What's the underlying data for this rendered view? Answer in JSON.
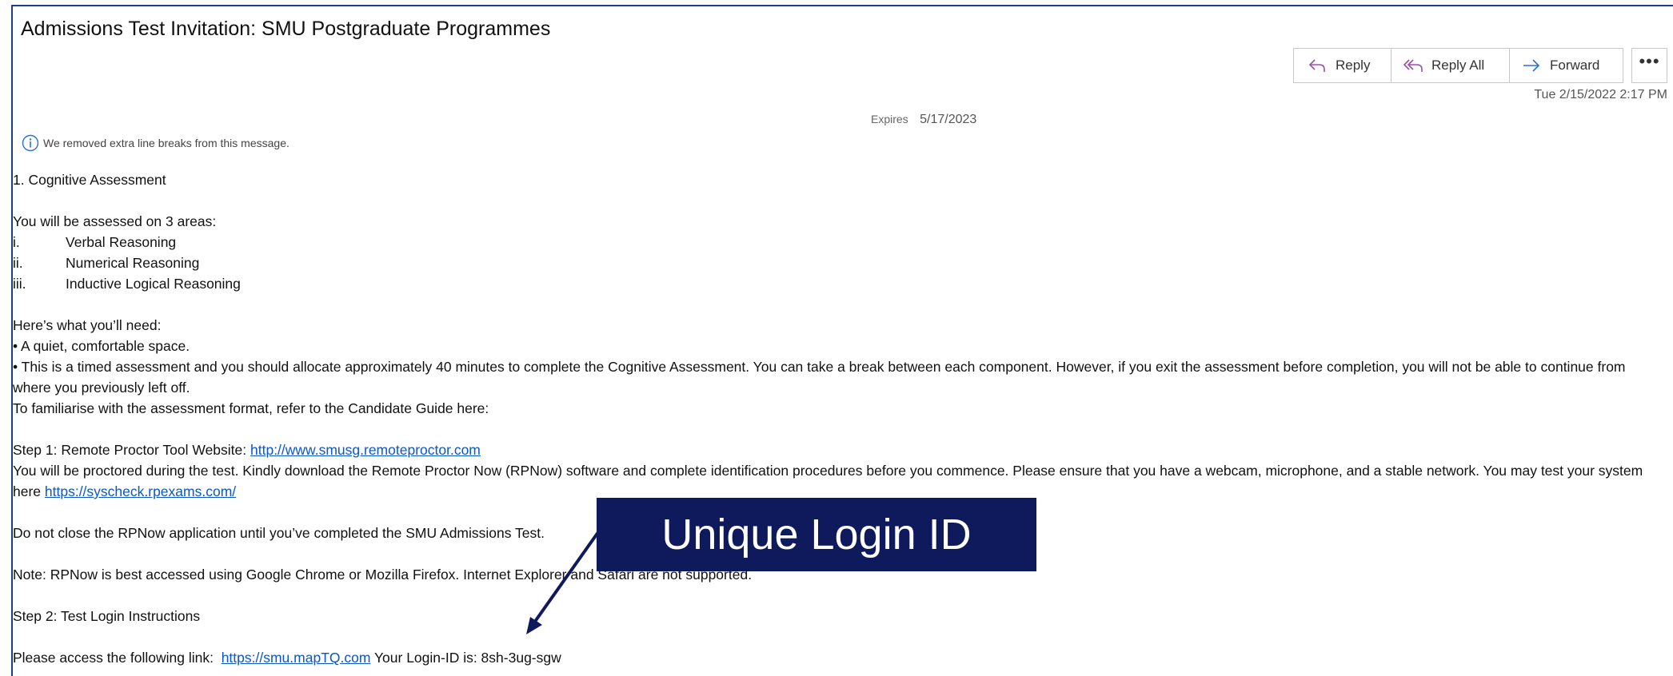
{
  "email": {
    "subject": "Admissions Test Invitation: SMU Postgraduate Programmes",
    "actions": {
      "reply": "Reply",
      "reply_all": "Reply All",
      "forward": "Forward",
      "more_icon": "more-horizontal-icon"
    },
    "date": "Tue 2/15/2022 2:17 PM",
    "expires_label": "Expires",
    "expires_value": "5/17/2023",
    "notice": "We removed extra line breaks from this message."
  },
  "body": {
    "heading1": "1. Cognitive Assessment",
    "intro": "You will be assessed on 3 areas:",
    "areas": [
      {
        "num": "i.",
        "label": "Verbal Reasoning"
      },
      {
        "num": "ii.",
        "label": "Numerical Reasoning"
      },
      {
        "num": "iii.",
        "label": "Inductive Logical Reasoning"
      }
    ],
    "need_heading": "Here’s what you’ll need:",
    "need_1": "• A quiet, comfortable space.",
    "need_2": "• This is a timed assessment and you should allocate approximately 40 minutes to complete the Cognitive Assessment. You can take a break between each component. However, if you exit the assessment before completion, you will not be able to continue from where you previously left off.",
    "familiarise": "To familiarise with the assessment format, refer to the Candidate Guide here:",
    "step1_prefix": "Step 1: Remote Proctor Tool Website: ",
    "step1_link": "http://www.smusg.remoteproctor.com",
    "proctor_text": "You will be proctored during the test. Kindly download the Remote Proctor Now (RPNow) software and complete identification procedures before you commence. Please ensure that you have a webcam, microphone, and a stable network. You may test your system here ",
    "syscheck_link": "https://syscheck.rpexams.com/",
    "do_not_close": "Do not close the RPNow application until you’ve completed the SMU Admissions Test.",
    "note": "Note: RPNow is best accessed using Google Chrome or Mozilla Firefox. Internet Explorer and Safari are not supported.",
    "step2": "Step 2: Test Login Instructions",
    "access_prefix": "Please access the following link:  ",
    "access_link": "https://smu.mapTQ.com",
    "login_text": " Your Login-ID is: 8sh-3ug-sgw"
  },
  "annotation": {
    "callout": "Unique Login ID",
    "color": "#0f1a5c"
  }
}
